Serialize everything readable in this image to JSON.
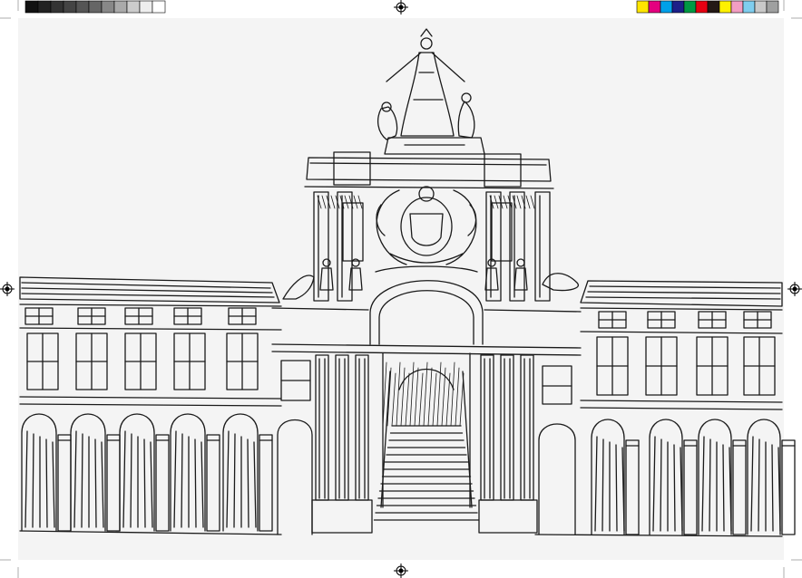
{
  "print_marks": {
    "grayscale_bar": [
      "#111111",
      "#222222",
      "#333333",
      "#444444",
      "#555555",
      "#666666",
      "#888888",
      "#aaaaaa",
      "#cccccc",
      "#eeeeee",
      "#ffffff"
    ],
    "color_bar": [
      "#ffe600",
      "#e4007f",
      "#00a0e9",
      "#1d2088",
      "#009944",
      "#e60012",
      "#231815",
      "#fff100",
      "#f29ec2",
      "#7fcdee",
      "#c9c9c9",
      "#9fa0a0"
    ],
    "registration_mark_icon": "crosshair-circle-icon"
  },
  "drawing": {
    "subject": "pen-sketch-triumphal-arch",
    "ink_color": "#1a1a1a",
    "paper_color": "#f4f4f4"
  }
}
